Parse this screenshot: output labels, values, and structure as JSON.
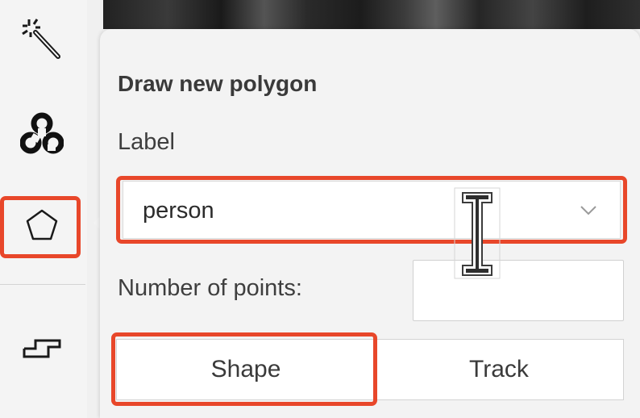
{
  "toolbar": {
    "tools": [
      {
        "name": "magic-wand-tool",
        "icon": "magic-wand-icon"
      },
      {
        "name": "opencv-tool",
        "icon": "opencv-icon"
      },
      {
        "name": "draw-polygon-tool",
        "icon": "pentagon-icon",
        "selected": true
      },
      {
        "name": "draw-polyline-tool",
        "icon": "polyline-icon"
      }
    ]
  },
  "panel": {
    "title": "Draw new polygon",
    "label_caption": "Label",
    "label_value": "person",
    "points_caption": "Number of points:",
    "points_value": "",
    "shape_label": "Shape",
    "track_label": "Track"
  },
  "colors": {
    "highlight": "#e8472a",
    "background": "#f3f3f3"
  }
}
